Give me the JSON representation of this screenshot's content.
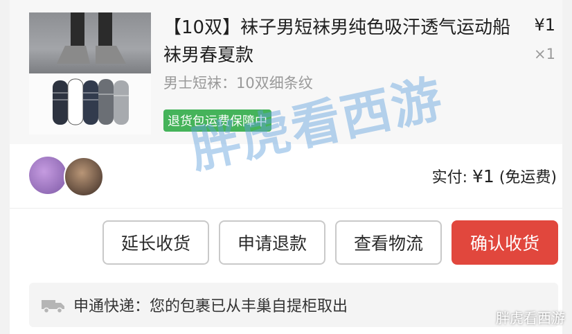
{
  "product": {
    "title": "【10双】袜子男短袜男纯色吸汗透气运动船袜男春夏款",
    "price": "¥1",
    "quantity": "×1",
    "sku": "男士短袜：10双细条纹",
    "badge": "退货包运费保障中"
  },
  "payment": {
    "label": "实付: ",
    "amount": "¥1",
    "note": " (免运费)"
  },
  "buttons": {
    "extend_receipt": "延长收货",
    "refund": "申请退款",
    "view_logistics": "查看物流",
    "confirm_receipt": "确认收货"
  },
  "logistics": {
    "icon": "truck-icon",
    "status_text": "申通快递：您的包裹已从丰巢自提柜取出"
  },
  "watermarks": {
    "center": "胖虎看西游",
    "corner": "胖虎看西游"
  },
  "colors": {
    "confirm_button_bg": "#e1473d",
    "badge_bg": "#45b35a"
  }
}
